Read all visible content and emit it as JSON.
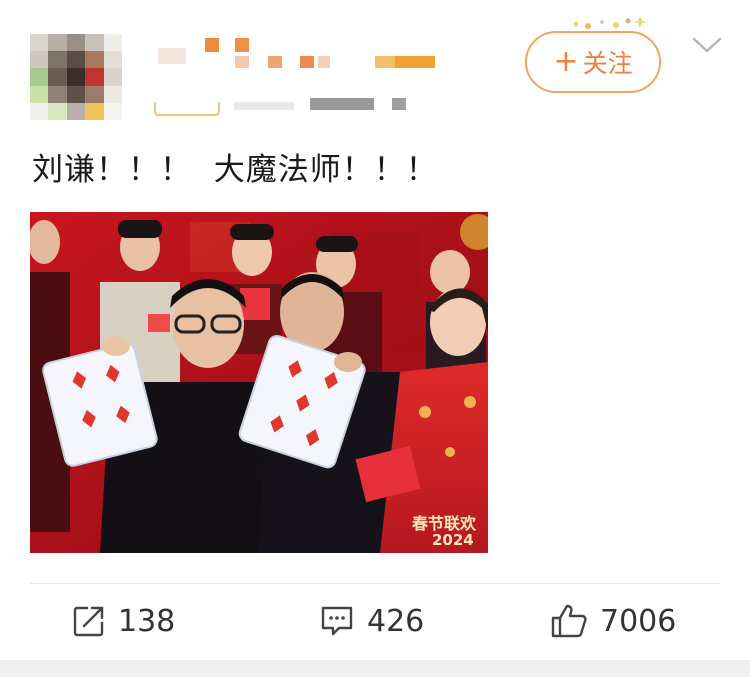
{
  "header": {
    "follow_label": "关注",
    "follow_plus": "+"
  },
  "post": {
    "text": "刘谦！！！  大魔法师！！！"
  },
  "photo": {
    "caption_line1": "春节联欢",
    "caption_line2": "2024"
  },
  "actions": {
    "repost_count": "138",
    "comment_count": "426",
    "like_count": "7006"
  },
  "colors": {
    "accent": "#f0803c",
    "stage_red": "#b0121a"
  },
  "icons": {
    "repost": "share-square-icon",
    "comment": "comment-bubble-icon",
    "like": "thumbs-up-icon",
    "more": "chevron-down-icon"
  }
}
